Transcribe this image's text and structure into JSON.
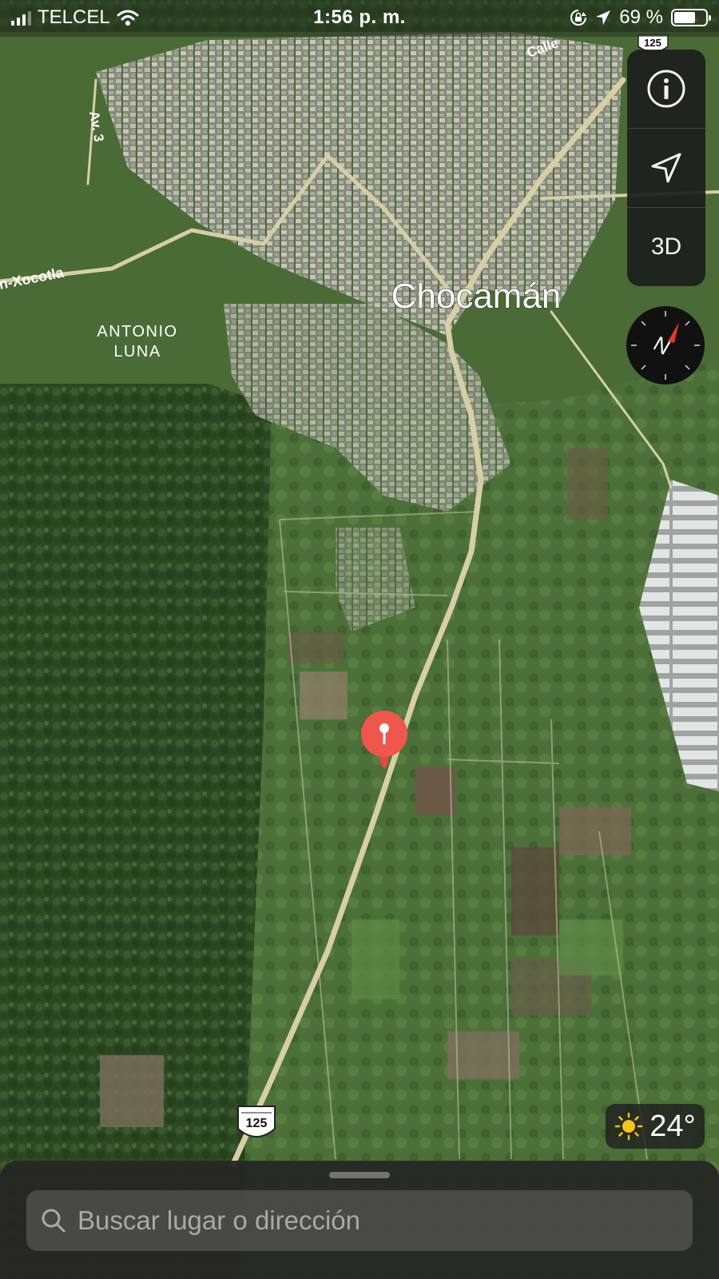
{
  "status_bar": {
    "carrier": "TELCEL",
    "time": "1:56 p. m.",
    "battery_percent": "69 %",
    "battery_level": 0.69,
    "icons": [
      "signal-icon",
      "wifi-icon",
      "orientation-lock-icon",
      "location-arrow-icon",
      "battery-icon"
    ]
  },
  "map": {
    "type": "satellite",
    "labels": {
      "town": "Chocamán",
      "neighborhood_line1": "ANTONIO",
      "neighborhood_line2": "LUNA",
      "road_west": "n-Xocotla",
      "road_av3": "Av. 3",
      "road_calle": "Calle",
      "highway_shield": "125",
      "highway_shield_top": "125"
    },
    "pin_color": "#f0574c",
    "road_color": "#d6cfa6"
  },
  "controls": {
    "info_icon": "info-icon",
    "location_icon": "location-arrow-icon",
    "three_d_label": "3D",
    "compass_icon": "compass-icon",
    "compass_letter": "N"
  },
  "weather": {
    "icon": "sun-icon",
    "temperature": "24°"
  },
  "search": {
    "placeholder": "Buscar lugar o dirección",
    "icon": "search-icon"
  }
}
